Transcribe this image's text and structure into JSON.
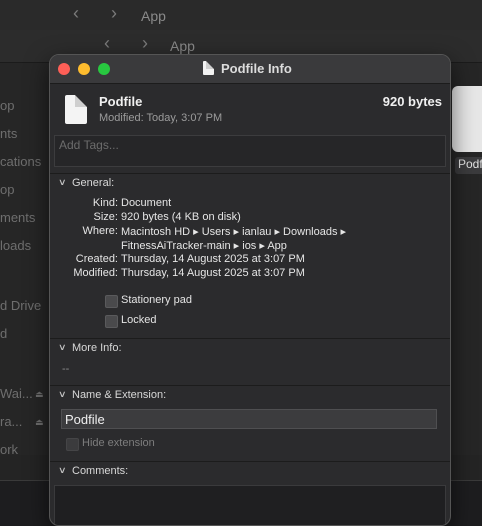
{
  "background": {
    "back_window_title": "App",
    "front_window_title": "App",
    "sidebar_items": [
      "op",
      "nts",
      "cations",
      "op",
      "ments",
      "loads",
      "d Drive",
      "d",
      "Wai...",
      "ra...",
      "ork"
    ],
    "right_item_label": "Podf"
  },
  "info_window": {
    "title": "Podfile Info",
    "file_name": "Podfile",
    "file_size": "920 bytes",
    "modified_summary": "Modified: Today, 3:07 PM",
    "tags_placeholder": "Add Tags...",
    "general": {
      "header": "General:",
      "rows": [
        {
          "key": "Kind:",
          "value": "Document"
        },
        {
          "key": "Size:",
          "value": "920 bytes (4 KB on disk)"
        },
        {
          "key": "Where:",
          "value": "Macintosh HD ▸ Users ▸ ianlau ▸ Downloads ▸"
        },
        {
          "key": "",
          "value": "FitnessAiTracker-main ▸ ios ▸ App"
        },
        {
          "key": "Created:",
          "value": "Thursday, 14 August 2025 at 3:07 PM"
        },
        {
          "key": "Modified:",
          "value": "Thursday, 14 August 2025 at 3:07 PM"
        }
      ],
      "stationery_pad_label": "Stationery pad",
      "locked_label": "Locked"
    },
    "more_info": {
      "header": "More Info:",
      "value": "--"
    },
    "name_extension": {
      "header": "Name & Extension:",
      "name_value": "Podfile",
      "hide_extension_label": "Hide extension"
    },
    "comments": {
      "header": "Comments:"
    }
  },
  "colors": {
    "window_bg": "#2b2b2d",
    "close": "#fe5f57",
    "minimize": "#febc2e",
    "zoom": "#28c840"
  }
}
